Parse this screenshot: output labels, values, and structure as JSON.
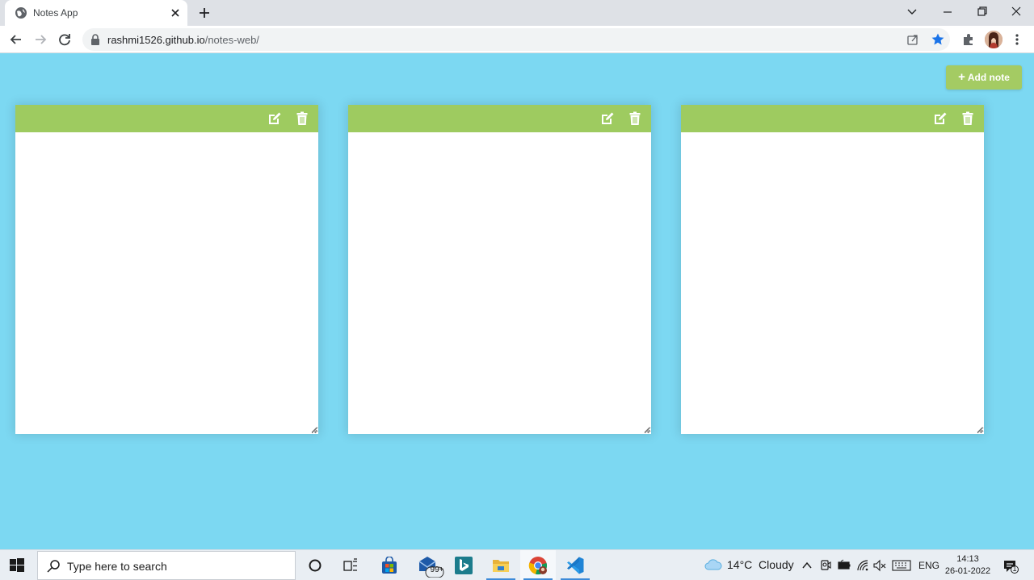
{
  "browser": {
    "tab_title": "Notes App",
    "url_host": "rashmi1526.github.io",
    "url_path": "/notes-web/"
  },
  "app": {
    "add_note_label": "Add note",
    "accent_color": "#9ecb60",
    "background_color": "#7cd8f2",
    "notes": [
      {
        "text": ""
      },
      {
        "text": ""
      },
      {
        "text": ""
      }
    ]
  },
  "taskbar": {
    "search_placeholder": "Type here to search",
    "mail_badge": "99+",
    "weather": "14°C  Cloudy",
    "language": "ENG",
    "time": "14:13",
    "date": "26-01-2022",
    "notification_count": "1",
    "apps": [
      "cortana-icon",
      "task-view-icon",
      "store-icon",
      "mail-icon",
      "bing-icon",
      "file-explorer-icon",
      "chrome-icon",
      "vscode-icon"
    ]
  }
}
